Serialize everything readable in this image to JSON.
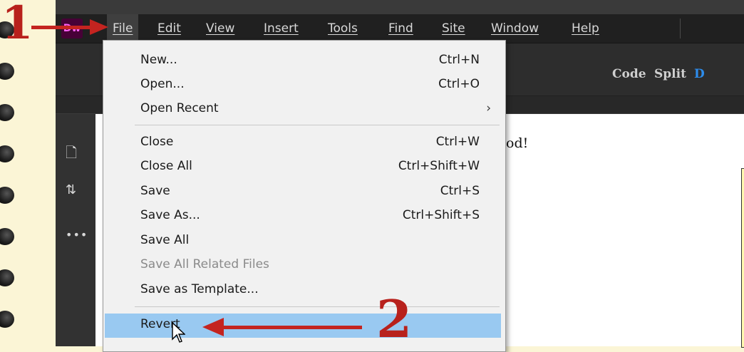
{
  "app": {
    "logo_text": "Dw",
    "menubar": [
      "File",
      "Edit",
      "View",
      "Insert",
      "Tools",
      "Find",
      "Site",
      "Window",
      "Help"
    ],
    "view_buttons": [
      "Code",
      "Split",
      "D"
    ],
    "doc_text": "od!"
  },
  "file_menu": {
    "items": [
      {
        "label": "New...",
        "shortcut": "Ctrl+N"
      },
      {
        "label": "Open...",
        "shortcut": "Ctrl+O"
      },
      {
        "label": "Open Recent",
        "shortcut": "",
        "submenu": true
      },
      {
        "label": "Close",
        "shortcut": "Ctrl+W"
      },
      {
        "label": "Close All",
        "shortcut": "Ctrl+Shift+W"
      },
      {
        "label": "Save",
        "shortcut": "Ctrl+S"
      },
      {
        "label": "Save As...",
        "shortcut": "Ctrl+Shift+S"
      },
      {
        "label": "Save All",
        "shortcut": ""
      },
      {
        "label": "Save All Related Files",
        "shortcut": "",
        "disabled": true
      },
      {
        "label": "Save as Template...",
        "shortcut": ""
      },
      {
        "label": "Revert",
        "shortcut": "",
        "highlighted": true
      }
    ]
  },
  "annotations": {
    "step1": "1",
    "step2": "2"
  },
  "colors": {
    "page_bg": "#fbf5d6",
    "menubar_bg": "#202020",
    "highlight": "#99c9f1",
    "annotation_red": "#c42420",
    "logo_bg": "#470137"
  }
}
